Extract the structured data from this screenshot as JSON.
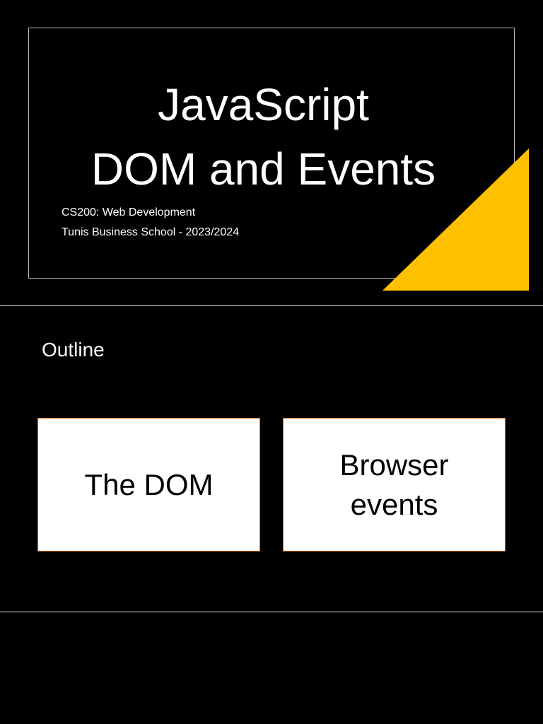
{
  "slide1": {
    "title_line1": "JavaScript",
    "title_line2": "DOM and Events",
    "subtitle_line1": "CS200: Web Development",
    "subtitle_line2": "Tunis Business School - 2023/2024",
    "accent_color": "#FFC000"
  },
  "slide2": {
    "heading": "Outline",
    "cards": [
      {
        "label": "The DOM"
      },
      {
        "label": "Browser events"
      }
    ],
    "card_border_color": "#E46C0A"
  }
}
